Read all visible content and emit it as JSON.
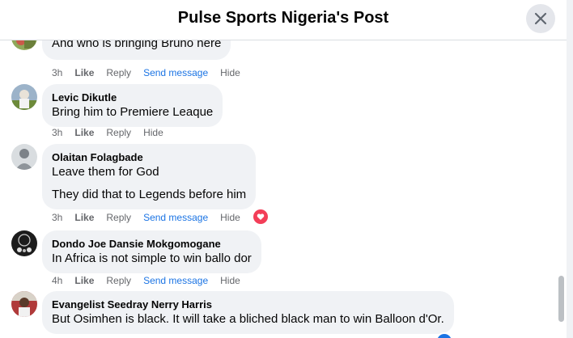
{
  "dialog": {
    "title": "Pulse Sports Nigeria's Post",
    "close_icon": "close-icon"
  },
  "comments": [
    {
      "author": "",
      "lines": [
        "And who is bringing Bruno here"
      ],
      "time": "3h",
      "like": "Like",
      "reply": "Reply",
      "send_message": "Send message",
      "hide": "Hide"
    },
    {
      "author": "Levic Dikutle",
      "lines": [
        "Bring him to Premiere Leaque"
      ],
      "time": "3h",
      "like": "Like",
      "reply": "Reply",
      "hide": "Hide"
    },
    {
      "author": "Olaitan Folagbade",
      "lines": [
        "Leave them for God",
        "They did that to Legends before him"
      ],
      "time": "3h",
      "like": "Like",
      "reply": "Reply",
      "send_message": "Send message",
      "hide": "Hide",
      "reaction": "heart-icon"
    },
    {
      "author": "Dondo Joe Dansie Mokgomogane",
      "lines": [
        "In Africa is not simple to win ballo dor"
      ],
      "time": "4h",
      "like": "Like",
      "reply": "Reply",
      "send_message": "Send message",
      "hide": "Hide"
    },
    {
      "author": "Evangelist Seedray Nerry Harris",
      "lines": [
        "But Osimhen is black. It will take a bliched black man to win Balloon d'Or."
      ],
      "time": "",
      "like": "",
      "reply": "",
      "hide": ""
    }
  ],
  "colors": {
    "accent": "#1b74e4",
    "bubble": "#f0f2f5",
    "meta": "#65676b",
    "heart": "#f33e58"
  }
}
